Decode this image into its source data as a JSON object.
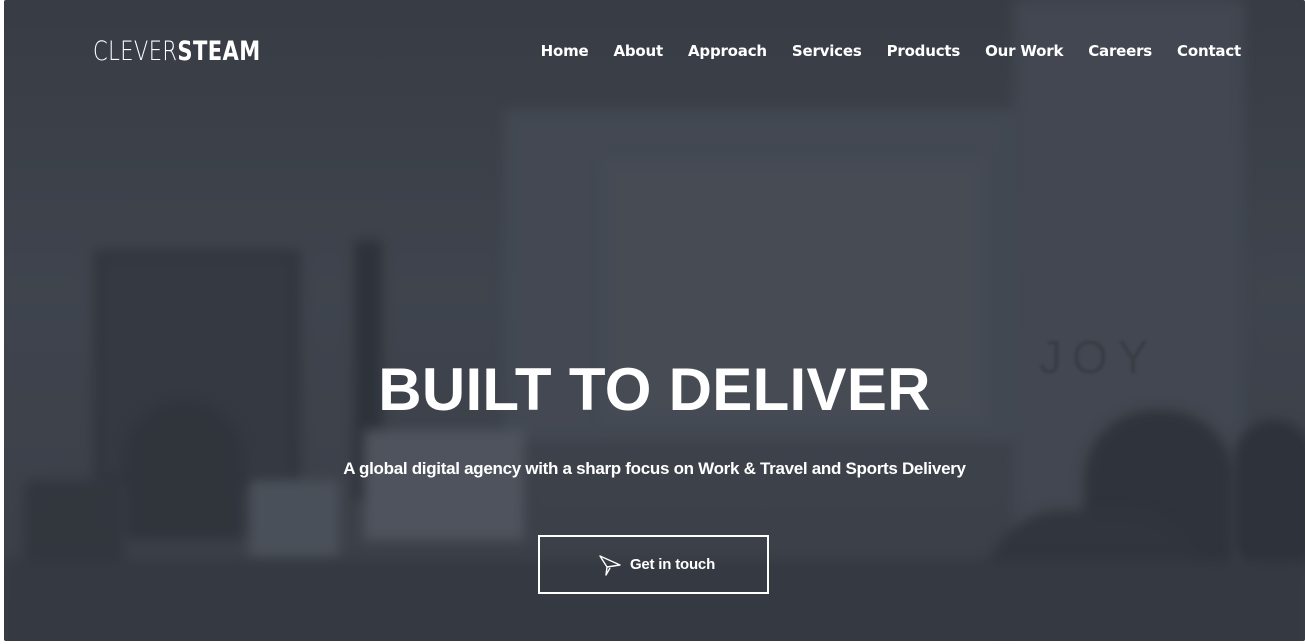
{
  "brand": {
    "logo_light": "CLEVER",
    "logo_bold": "STEAM"
  },
  "nav": {
    "items": [
      {
        "label": "Home"
      },
      {
        "label": "About"
      },
      {
        "label": "Approach"
      },
      {
        "label": "Services"
      },
      {
        "label": "Products"
      },
      {
        "label": "Our Work"
      },
      {
        "label": "Careers"
      },
      {
        "label": "Contact"
      }
    ]
  },
  "hero": {
    "headline": "BUILT TO DELIVER",
    "subheadline": "A global digital agency with a sharp focus on Work & Travel and Sports Delivery",
    "cta_label": "Get in touch",
    "cta_icon": "paper-plane-icon",
    "background_sign_text": "JOY"
  },
  "colors": {
    "hero_background": "#3e424b",
    "text": "#ffffff",
    "cta_border": "#ffffff"
  }
}
